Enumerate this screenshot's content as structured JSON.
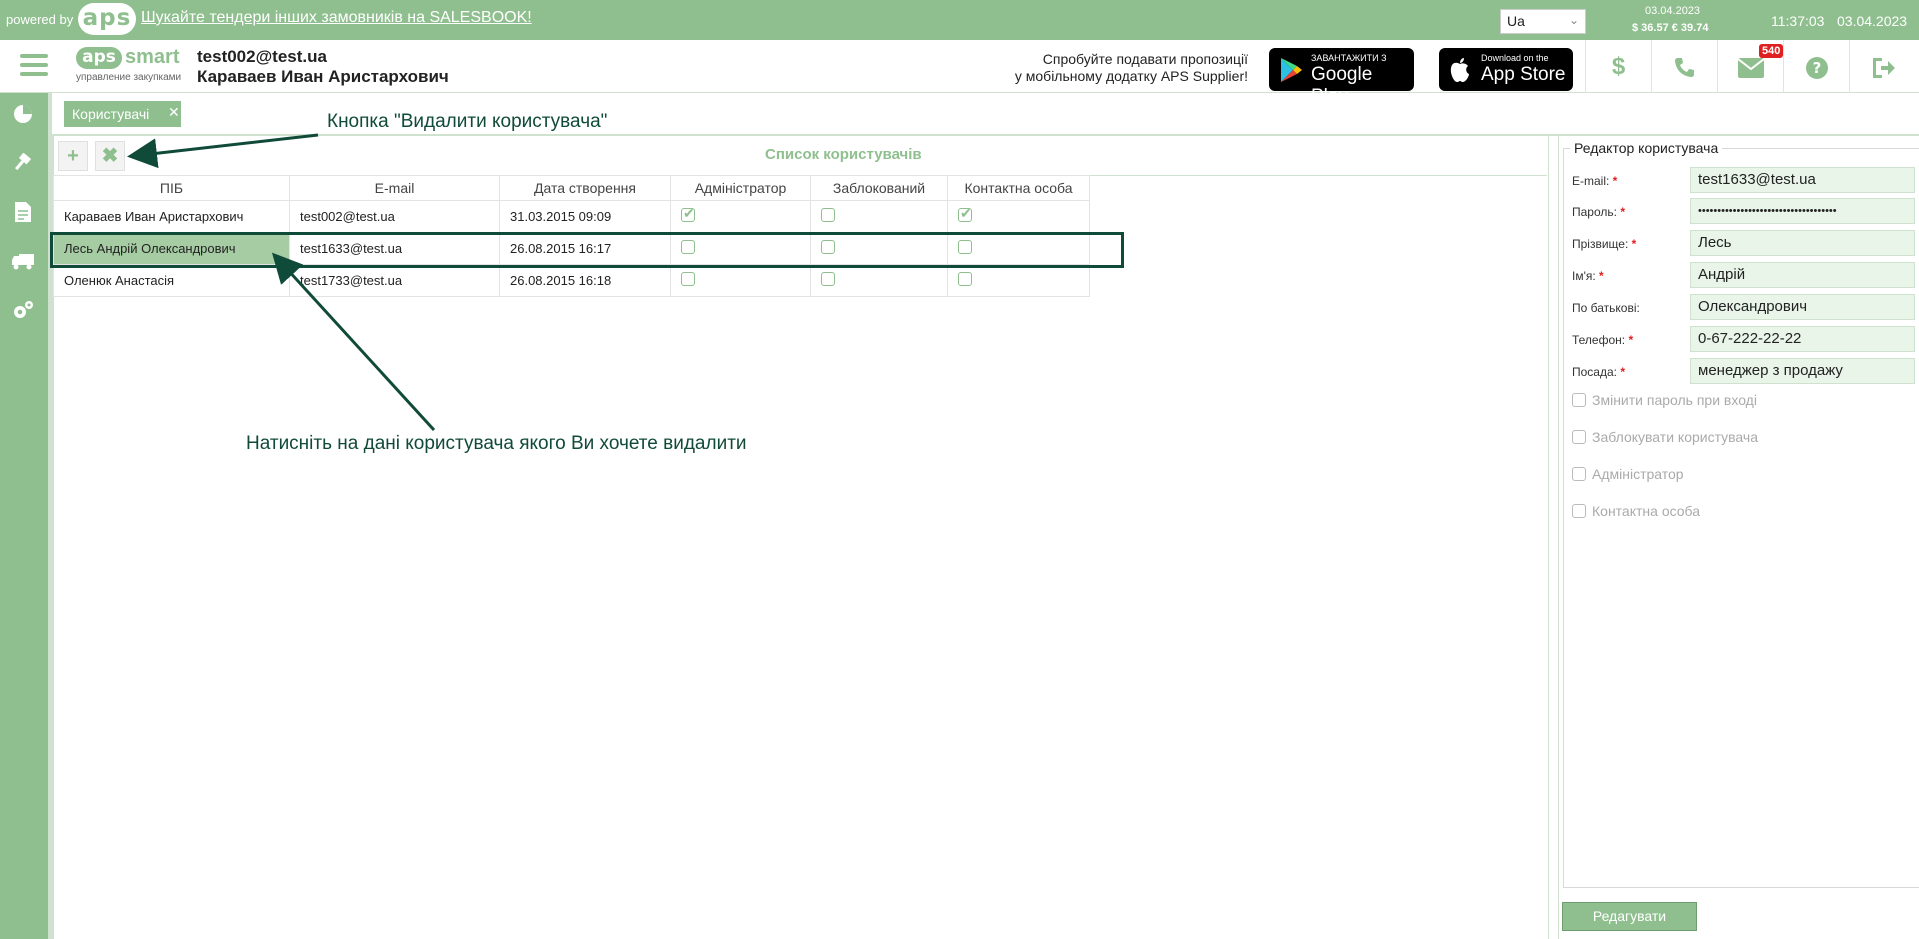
{
  "topbar": {
    "powered_by": "powered by",
    "logo": "aps",
    "promo_link": "Шукайте тендери інших замовників на SALESBOOK!",
    "language": "Ua",
    "rates_date": "03.04.2023",
    "rates": "$ 36.57  € 39.74",
    "time": "11:37:03",
    "date": "03.04.2023"
  },
  "header": {
    "logo_aps": "aps",
    "logo_smart": "smart",
    "logo_sub": "управление закупками",
    "user_email": "test002@test.ua",
    "user_name": "Караваев Иван Аристархович",
    "promo_line1": "Спробуйте подавати пропозиції",
    "promo_line2": "у мобільному додатку APS Supplier!",
    "google_small": "ЗАВАНТАЖИТИ З",
    "google_big": "Google Play",
    "apple_small": "Download on the",
    "apple_big": "App Store",
    "mail_badge": "540"
  },
  "tabs": [
    {
      "label": "Користувачі"
    }
  ],
  "list": {
    "title": "Список користувачів",
    "columns": [
      "ПІБ",
      "E-mail",
      "Дата створення",
      "Адміністратор",
      "Заблокований",
      "Контактна особа"
    ],
    "rows": [
      {
        "name": "Караваев Иван Аристархович",
        "email": "test002@test.ua",
        "created": "31.03.2015 09:09",
        "admin": true,
        "blocked": false,
        "contact": true
      },
      {
        "name": "Лесь Андрій Олександрович",
        "email": "test1633@test.ua",
        "created": "26.08.2015 16:17",
        "admin": false,
        "blocked": false,
        "contact": false
      },
      {
        "name": "Оленюк Анастасія",
        "email": "test1733@test.ua",
        "created": "26.08.2015 16:18",
        "admin": false,
        "blocked": false,
        "contact": false
      }
    ]
  },
  "annotations": {
    "delete_hint": "Кнопка \"Видалити користувача\"",
    "click_hint": "Натисніть на дані користувача якого Ви хочете видалити"
  },
  "editor": {
    "title": "Редактор користувача",
    "fields": [
      {
        "label": "E-mail:",
        "required": true,
        "value": "test1633@test.ua"
      },
      {
        "label": "Пароль:",
        "required": true,
        "value": "••••••••••••••••••••••••••••••••••••"
      },
      {
        "label": "Прізвище:",
        "required": true,
        "value": "Лесь"
      },
      {
        "label": "Ім'я:",
        "required": true,
        "value": "Андрій"
      },
      {
        "label": "По батькові:",
        "required": false,
        "value": "Олександрович"
      },
      {
        "label": "Телефон:",
        "required": true,
        "value": "0-67-222-22-22"
      },
      {
        "label": "Посада:",
        "required": true,
        "value": "менеджер з продажу"
      }
    ],
    "options": [
      "Змінити пароль при вході",
      "Заблокувати користувача",
      "Адміністратор",
      "Контактна особа"
    ],
    "edit_button": "Редагувати"
  },
  "colors": {
    "brand_green": "#8fbf8e",
    "annotation": "#104a39",
    "required": "#e02020"
  },
  "icons": {
    "sidebar": [
      "dashboard-icon",
      "auction-hammer-icon",
      "document-icon",
      "truck-icon",
      "settings-icon"
    ],
    "header": [
      "dollar-icon",
      "phone-icon",
      "mail-icon",
      "help-icon",
      "logout-icon"
    ]
  }
}
